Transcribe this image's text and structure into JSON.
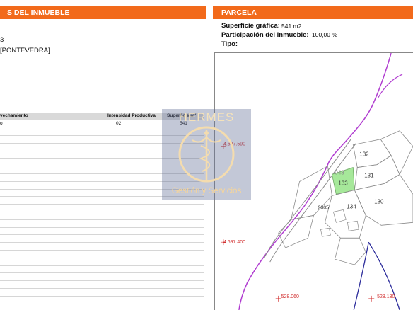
{
  "left_panel": {
    "header": "S DEL INMUEBLE",
    "fragment_number": "3",
    "fragment_province": "[PONTEVEDRA]"
  },
  "table": {
    "headers": [
      "vechamiento",
      "Intensidad Productiva",
      "Superficie m²"
    ],
    "rows": [
      {
        "col_a": "o",
        "col_b": "02",
        "col_c": "541"
      }
    ]
  },
  "right_panel": {
    "header": "PARCELA",
    "superficie_label": "Superficie gráfica:",
    "superficie_value": "541 m2",
    "participacion_label": "Participación del inmueble:",
    "participacion_value": "100,00 %",
    "tipo_label": "Tipo:"
  },
  "map": {
    "coord_y_top": "4.697.590",
    "coord_y_bottom": "4.697.400",
    "coord_x_left": "528.060",
    "coord_x_right": "528.130",
    "highlight_code": "043",
    "parcels": [
      "132",
      "131",
      "133",
      "130",
      "134",
      "9005"
    ],
    "colors": {
      "boundary": "#b03cd0",
      "highlight_fill": "#a6e89a",
      "blue_line": "#2a2a9a",
      "coord_text": "#d23030"
    }
  },
  "watermark": {
    "top_text": "HERMES",
    "bottom_text": "Gestión y Servicios"
  }
}
